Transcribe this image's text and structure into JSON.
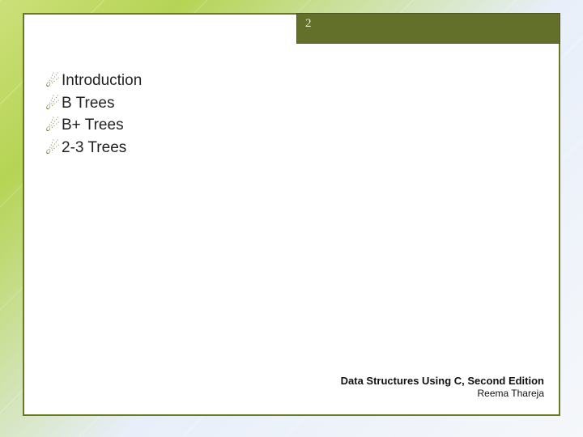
{
  "page_number": "2",
  "bullets": {
    "b0": "Introduction",
    "b1": "B Trees",
    "b2": "B+ Trees",
    "b3": "2-3 Trees"
  },
  "footer": {
    "title": "Data Structures Using C, Second Edition",
    "author": "Reema Thareja"
  },
  "glyphs": {
    "bullet": "☄"
  }
}
